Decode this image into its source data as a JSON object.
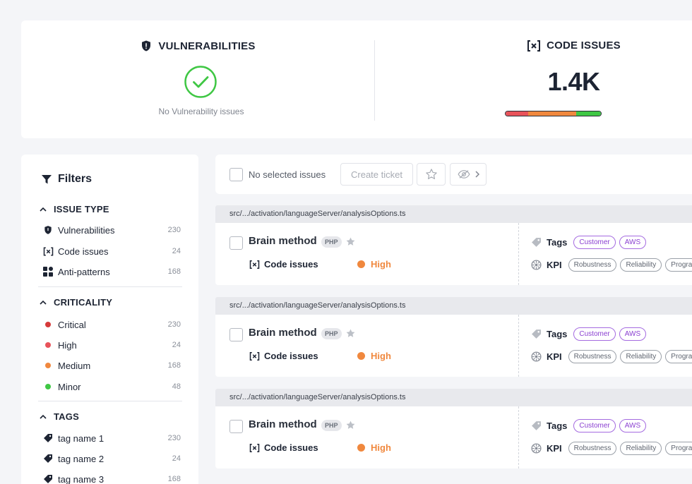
{
  "summary": {
    "vulnerabilities": {
      "title": "VULNERABILITIES",
      "empty_text": "No Vulnerability issues",
      "icon": "shield-alert-icon"
    },
    "code_issues": {
      "title": "CODE ISSUES",
      "count": "1.4K",
      "icon": "code-brackets-icon",
      "severity_bar": [
        {
          "color": "#e8535a",
          "fraction": 0.24
        },
        {
          "color": "#f0883e",
          "fraction": 0.5
        },
        {
          "color": "#3fc744",
          "fraction": 0.26
        }
      ]
    }
  },
  "filters": {
    "title": "Filters",
    "groups": [
      {
        "label": "ISSUE TYPE",
        "items": [
          {
            "label": "Vulnerabilities",
            "count": "230",
            "icon": "shield-icon"
          },
          {
            "label": "Code issues",
            "count": "24",
            "icon": "code-brackets-icon"
          },
          {
            "label": "Anti-patterns",
            "count": "168",
            "icon": "blocks-icon"
          }
        ]
      },
      {
        "label": "CRITICALITY",
        "items": [
          {
            "label": "Critical",
            "count": "230",
            "color": "#d63a3a"
          },
          {
            "label": "High",
            "count": "24",
            "color": "#e8535a"
          },
          {
            "label": "Medium",
            "count": "168",
            "color": "#f0883e"
          },
          {
            "label": "Minor",
            "count": "48",
            "color": "#3fc744"
          }
        ]
      },
      {
        "label": "TAGS",
        "items": [
          {
            "label": "tag name 1",
            "count": "230",
            "icon": "tag-icon"
          },
          {
            "label": "tag name 2",
            "count": "24",
            "icon": "tag-icon"
          },
          {
            "label": "tag name 3",
            "count": "168",
            "icon": "tag-icon"
          }
        ]
      }
    ]
  },
  "toolbar": {
    "selection_label": "No selected issues",
    "create_ticket_label": "Create ticket"
  },
  "issues": [
    {
      "path": "src/.../activation/languageServer/analysisOptions.ts",
      "title": "Brain method",
      "lang": "PHP",
      "type": "Code issues",
      "severity": "High",
      "tags_label": "Tags",
      "tags": [
        "Customer",
        "AWS"
      ],
      "kpi_label": "KPI",
      "kpis": [
        "Robustness",
        "Reliability",
        "Progra"
      ]
    },
    {
      "path": "src/.../activation/languageServer/analysisOptions.ts",
      "title": "Brain method",
      "lang": "PHP",
      "type": "Code issues",
      "severity": "High",
      "tags_label": "Tags",
      "tags": [
        "Customer",
        "AWS"
      ],
      "kpi_label": "KPI",
      "kpis": [
        "Robustness",
        "Reliability",
        "Progra"
      ]
    },
    {
      "path": "src/.../activation/languageServer/analysisOptions.ts",
      "title": "Brain method",
      "lang": "PHP",
      "type": "Code issues",
      "severity": "High",
      "tags_label": "Tags",
      "tags": [
        "Customer",
        "AWS"
      ],
      "kpi_label": "KPI",
      "kpis": [
        "Robustness",
        "Reliability",
        "Progra"
      ]
    }
  ]
}
